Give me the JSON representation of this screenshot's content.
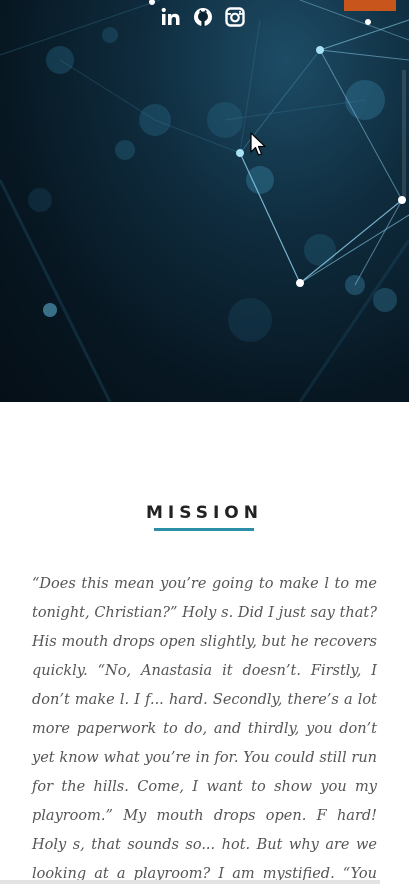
{
  "social_links": [
    {
      "icon": "linkedin-icon",
      "label": "in"
    },
    {
      "icon": "github-icon"
    },
    {
      "icon": "instagram-icon"
    }
  ],
  "colors": {
    "accent": "#2b8fa8",
    "orange_tab": "#c8551c",
    "hero_dark": "#071722"
  },
  "mission": {
    "title": "MISSION",
    "text": "“Does this mean you’re going to make l to me tonight, Christian?” Holy s. Did I just say that? His mouth drops open slightly, but he recovers quickly. “No, Anastasia it doesn’t. Firstly, I don’t make l. I f... hard. Secondly, there’s a lot more paperwork to do, and thirdly, you don’t yet know what you’re in for. You could still run for the hills. Come, I want to show you my playroom.” My mouth drops open. F hard! Holy s, that sounds so... hot. But why are we looking at a playroom? I am mystified. “You want to play on"
  }
}
